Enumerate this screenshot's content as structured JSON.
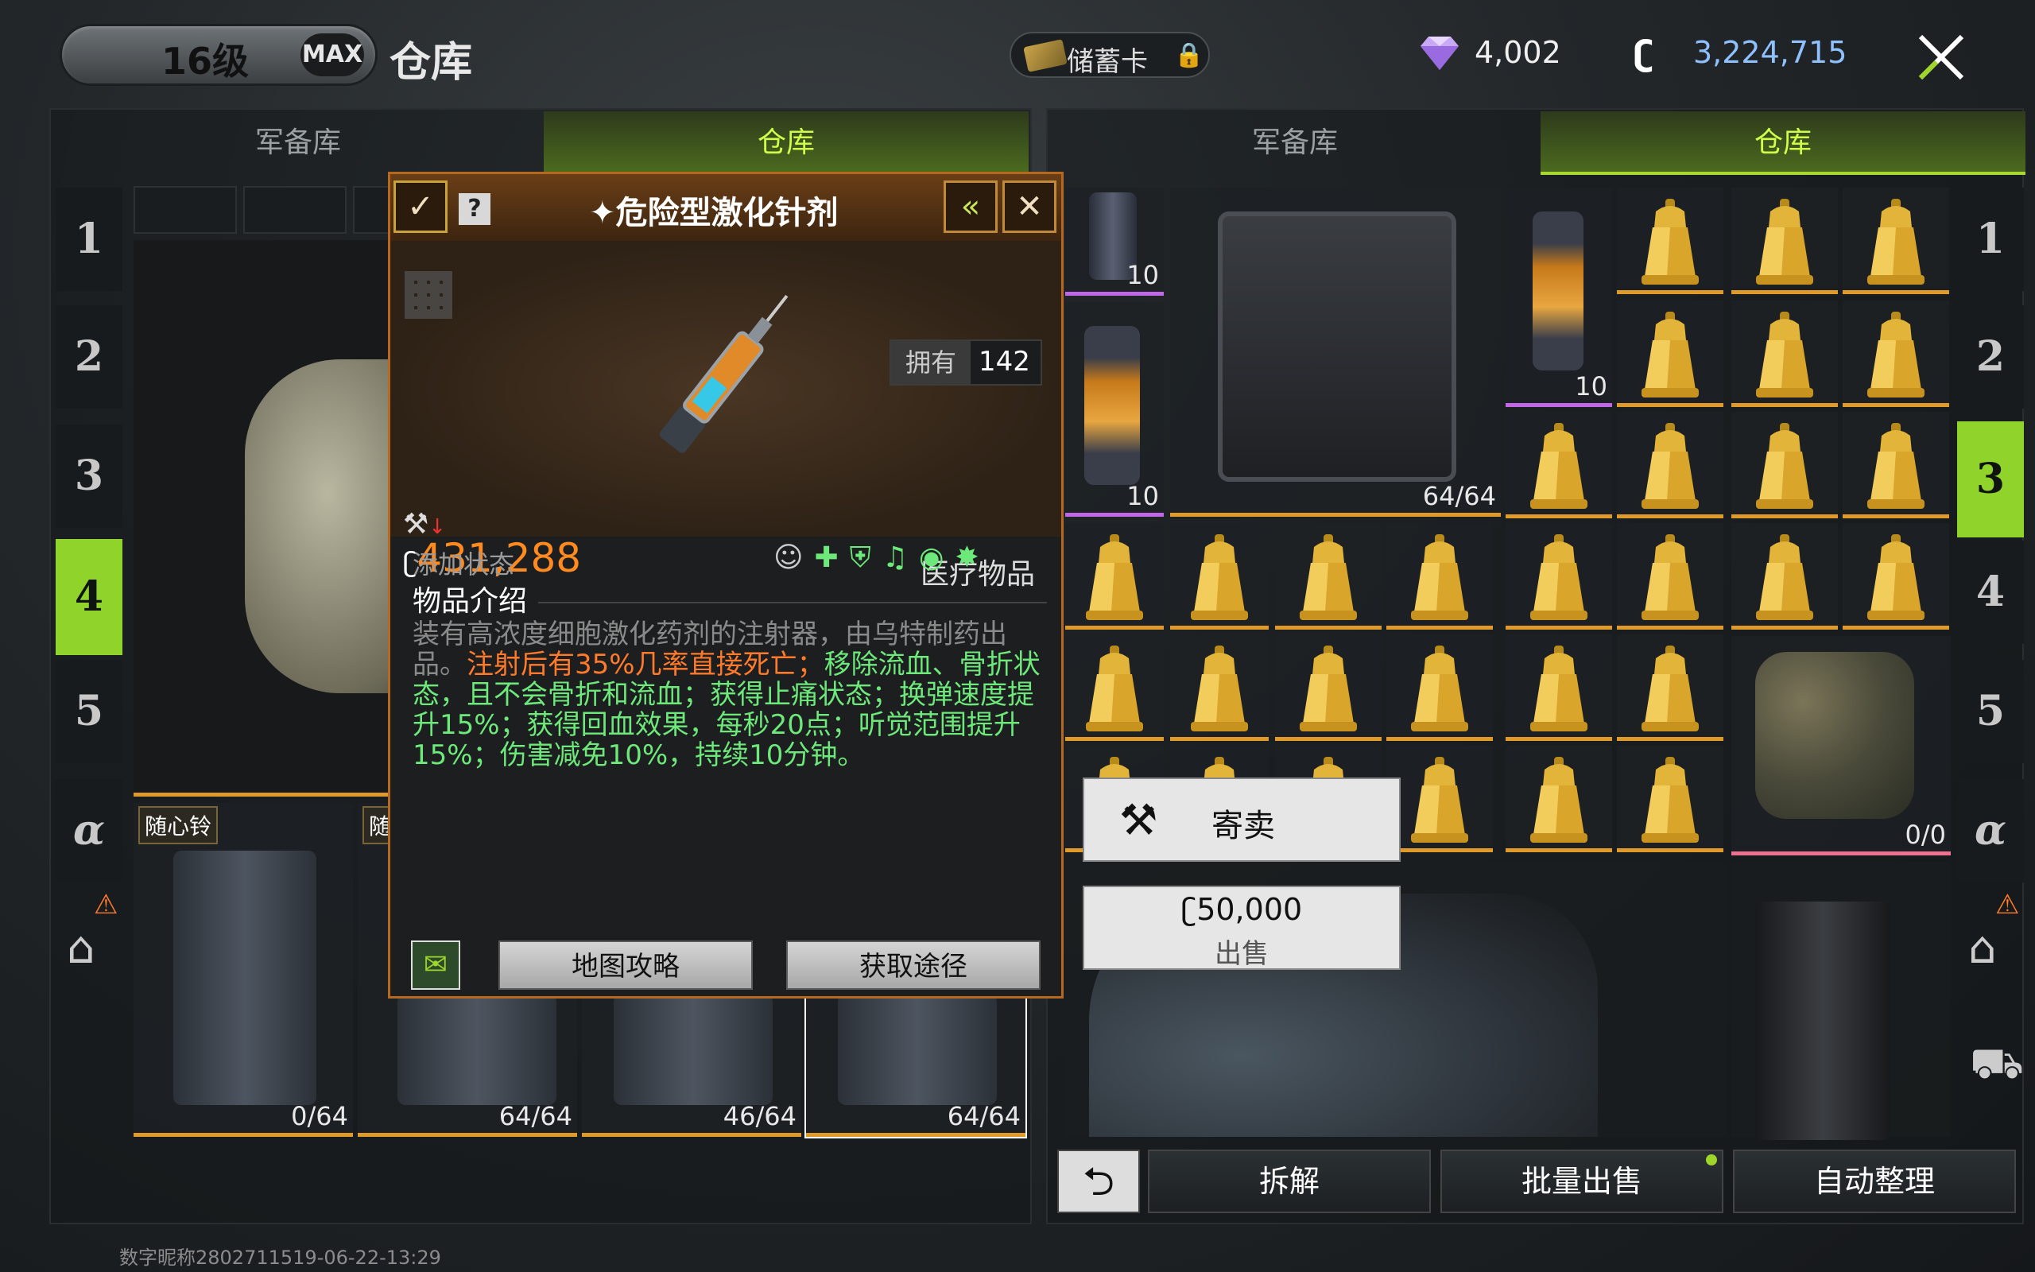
{
  "header": {
    "level": "16级",
    "max": "MAX",
    "title": "仓库",
    "card_label": "储蓄卡",
    "gems": "4,002",
    "coins": "3,224,715"
  },
  "left_panel": {
    "tabs": [
      "军备库",
      "仓库"
    ],
    "side": [
      "1",
      "2",
      "3",
      "4",
      "5",
      "α"
    ],
    "active_side": "4",
    "slot_label": "随心铃",
    "slot_label2": "随",
    "slot_counts": [
      "0/64",
      "64/64",
      "46/64",
      "64/64"
    ]
  },
  "right_panel": {
    "tabs": [
      "军备库",
      "仓库"
    ],
    "side": [
      "1",
      "2",
      "3",
      "4",
      "5",
      "α"
    ],
    "active_side": "3",
    "counts": {
      "can1": "10",
      "can2": "10",
      "can3": "10",
      "crate": "64/64",
      "backpack": "0/0"
    }
  },
  "popup": {
    "title": "危险型激化针剂",
    "owned_label": "拥有",
    "owned_value": "142",
    "price": "431,288",
    "category": "医疗物品",
    "add_state": "添加状态",
    "info_title": "物品介绍",
    "desc_gray": "装有高浓度细胞激化药剂的注射器，由乌特制药出品。",
    "desc_orange": "注射后有35%几率直接死亡；",
    "desc_green": "移除流血、骨折状态，且不会骨折和流血；获得止痛状态；换弹速度提升15%；获得回血效果，每秒20点；听觉范围提升15%；伤害减免10%，持续10分钟。",
    "btn_map": "地图攻略",
    "btn_source": "获取途径"
  },
  "actions": {
    "consign": "寄卖",
    "sell_price": "50,000",
    "sell": "出售"
  },
  "bottom": {
    "dismantle": "拆解",
    "batch_sell": "批量出售",
    "auto_sort": "自动整理"
  },
  "footer": "数字昵称2802711519-06-22-13:29",
  "colors": {
    "accent_green": "#8fd32b",
    "orange": "#e09a2a",
    "purple": "#c266e8"
  }
}
